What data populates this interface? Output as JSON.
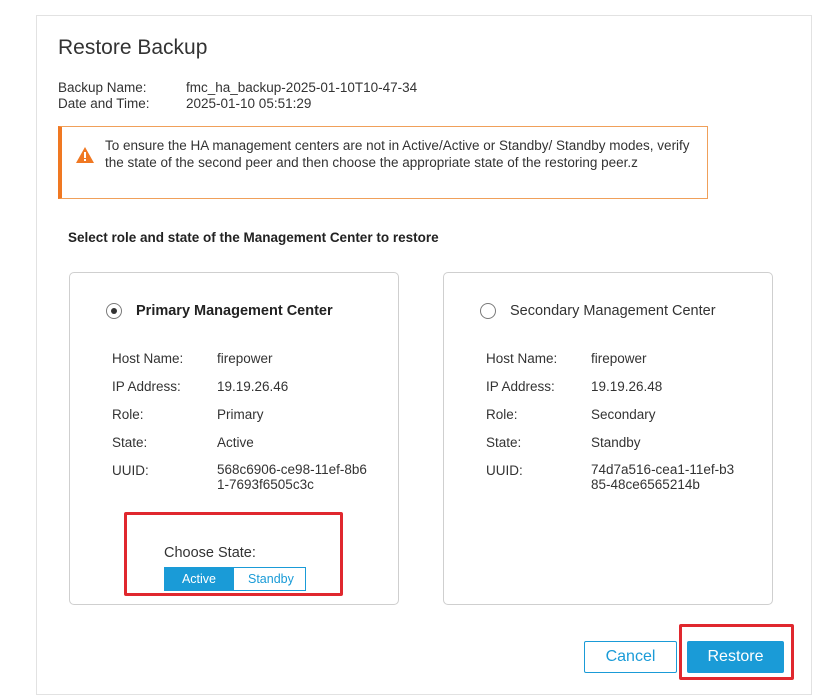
{
  "dialog": {
    "title": "Restore Backup",
    "backup_name_label": "Backup Name:",
    "backup_name_value": "fmc_ha_backup-2025-01-10T10-47-34",
    "datetime_label": "Date and Time:",
    "datetime_value": "2025-01-10 05:51:29"
  },
  "warning": {
    "icon": "warning-triangle-icon",
    "text": "To ensure the HA management centers are not in Active/Active or Standby/ Standby modes, verify the state of the second peer and then choose the appropriate state of the restoring peer.z",
    "color": "#f07822"
  },
  "section_title": "Select role and state of the Management Center to restore",
  "primary": {
    "label": "Primary Management Center",
    "selected": true,
    "host_label": "Host Name:",
    "host_value": "firepower",
    "ip_label": "IP Address:",
    "ip_value": "19.19.26.46",
    "role_label": "Role:",
    "role_value": "Primary",
    "state_label": "State:",
    "state_value": "Active",
    "uuid_label": "UUID:",
    "uuid_value": "568c6906-ce98-11ef-8b61-7693f6505c3c",
    "choose_state_label": "Choose State:",
    "choose_active": "Active",
    "choose_standby": "Standby",
    "choose_selected": "Active"
  },
  "secondary": {
    "label": "Secondary Management Center",
    "selected": false,
    "host_label": "Host Name:",
    "host_value": "firepower",
    "ip_label": "IP Address:",
    "ip_value": "19.19.26.48",
    "role_label": "Role:",
    "role_value": "Secondary",
    "state_label": "State:",
    "state_value": "Standby",
    "uuid_label": "UUID:",
    "uuid_value": "74d7a516-cea1-11ef-b385-48ce6565214b"
  },
  "buttons": {
    "cancel": "Cancel",
    "restore": "Restore"
  },
  "colors": {
    "accent": "#1a9bd7",
    "highlight": "#e0282e"
  }
}
